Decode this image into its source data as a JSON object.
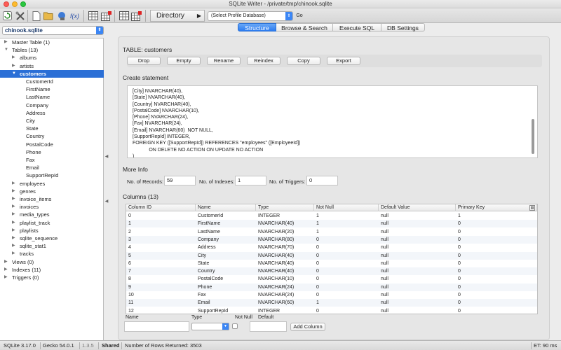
{
  "window": {
    "title": "SQLite Writer - /private/tmp/chinook.sqlite"
  },
  "toolbar": {
    "icons": [
      "refresh-icon",
      "tools-icon",
      "new-file-icon",
      "open-folder-icon",
      "save-icon",
      "function-icon",
      "table-icon",
      "table-delete-icon",
      "import-icon",
      "export-icon"
    ],
    "function_label": "f(x)",
    "directory_label": "Directory",
    "directory_arrow": "▶",
    "profile_select": "(Select Profile Database)",
    "go_label": "Go"
  },
  "sidebar": {
    "db_select": "chinook.sqlite",
    "tree": [
      {
        "label": "Master Table (1)",
        "indent": 0,
        "toggle": "▶",
        "selected": false
      },
      {
        "label": "Tables (13)",
        "indent": 0,
        "toggle": "▼",
        "selected": false
      },
      {
        "label": "albums",
        "indent": 1,
        "toggle": "▶",
        "selected": false
      },
      {
        "label": "artists",
        "indent": 1,
        "toggle": "▶",
        "selected": false
      },
      {
        "label": "customers",
        "indent": 1,
        "toggle": "▼",
        "selected": true
      },
      {
        "label": "CustomerId",
        "indent": 2,
        "toggle": "",
        "selected": false
      },
      {
        "label": "FirstName",
        "indent": 2,
        "toggle": "",
        "selected": false
      },
      {
        "label": "LastName",
        "indent": 2,
        "toggle": "",
        "selected": false
      },
      {
        "label": "Company",
        "indent": 2,
        "toggle": "",
        "selected": false
      },
      {
        "label": "Address",
        "indent": 2,
        "toggle": "",
        "selected": false
      },
      {
        "label": "City",
        "indent": 2,
        "toggle": "",
        "selected": false
      },
      {
        "label": "State",
        "indent": 2,
        "toggle": "",
        "selected": false
      },
      {
        "label": "Country",
        "indent": 2,
        "toggle": "",
        "selected": false
      },
      {
        "label": "PostalCode",
        "indent": 2,
        "toggle": "",
        "selected": false
      },
      {
        "label": "Phone",
        "indent": 2,
        "toggle": "",
        "selected": false
      },
      {
        "label": "Fax",
        "indent": 2,
        "toggle": "",
        "selected": false
      },
      {
        "label": "Email",
        "indent": 2,
        "toggle": "",
        "selected": false
      },
      {
        "label": "SupportRepId",
        "indent": 2,
        "toggle": "",
        "selected": false
      },
      {
        "label": "employees",
        "indent": 1,
        "toggle": "▶",
        "selected": false
      },
      {
        "label": "genres",
        "indent": 1,
        "toggle": "▶",
        "selected": false
      },
      {
        "label": "invoice_items",
        "indent": 1,
        "toggle": "▶",
        "selected": false
      },
      {
        "label": "invoices",
        "indent": 1,
        "toggle": "▶",
        "selected": false
      },
      {
        "label": "media_types",
        "indent": 1,
        "toggle": "▶",
        "selected": false
      },
      {
        "label": "playlist_track",
        "indent": 1,
        "toggle": "▶",
        "selected": false
      },
      {
        "label": "playlists",
        "indent": 1,
        "toggle": "▶",
        "selected": false
      },
      {
        "label": "sqlite_sequence",
        "indent": 1,
        "toggle": "▶",
        "selected": false
      },
      {
        "label": "sqlite_stat1",
        "indent": 1,
        "toggle": "▶",
        "selected": false
      },
      {
        "label": "tracks",
        "indent": 1,
        "toggle": "▶",
        "selected": false
      },
      {
        "label": "Views (0)",
        "indent": 0,
        "toggle": "▶",
        "selected": false
      },
      {
        "label": "Indexes (11)",
        "indent": 0,
        "toggle": "▶",
        "selected": false
      },
      {
        "label": "Triggers (0)",
        "indent": 0,
        "toggle": "▶",
        "selected": false
      }
    ]
  },
  "tabs": [
    {
      "label": "Structure",
      "active": true
    },
    {
      "label": "Browse & Search",
      "active": false
    },
    {
      "label": "Execute SQL",
      "active": false
    },
    {
      "label": "DB Settings",
      "active": false
    }
  ],
  "structure": {
    "table_title": "TABLE: customers",
    "buttons": [
      "Drop",
      "Empty",
      "Rename",
      "Reindex",
      "Copy",
      "Export"
    ],
    "create_title": "Create statement",
    "create_lines": [
      "[City] NVARCHAR(40),",
      "[State] NVARCHAR(40),",
      "[Country] NVARCHAR(40),",
      "[PostalCode] NVARCHAR(10),",
      "[Phone] NVARCHAR(24),",
      "[Fax] NVARCHAR(24),",
      "[Email] NVARCHAR(60)  NOT NULL,",
      "[SupportRepId] INTEGER,",
      "FOREIGN KEY ([SupportRepId]) REFERENCES \"employees\" ([EmployeeId])",
      "            ON DELETE NO ACTION ON UPDATE NO ACTION",
      ")"
    ],
    "more_info_title": "More Info",
    "records_label": "No. of Records:",
    "records_value": "59",
    "indexes_label": "No. of Indexes:",
    "indexes_value": "1",
    "triggers_label": "No. of Triggers:",
    "triggers_value": "0",
    "columns_title": "Columns (13)",
    "columns_headers": [
      "Column ID",
      "Name",
      "Type",
      "Not Null",
      "Default Value",
      "Primary Key"
    ],
    "columns_rows": [
      [
        "0",
        "CustomerId",
        "INTEGER",
        "1",
        "null",
        "1"
      ],
      [
        "1",
        "FirstName",
        "NVARCHAR(40)",
        "1",
        "null",
        "0"
      ],
      [
        "2",
        "LastName",
        "NVARCHAR(20)",
        "1",
        "null",
        "0"
      ],
      [
        "3",
        "Company",
        "NVARCHAR(80)",
        "0",
        "null",
        "0"
      ],
      [
        "4",
        "Address",
        "NVARCHAR(70)",
        "0",
        "null",
        "0"
      ],
      [
        "5",
        "City",
        "NVARCHAR(40)",
        "0",
        "null",
        "0"
      ],
      [
        "6",
        "State",
        "NVARCHAR(40)",
        "0",
        "null",
        "0"
      ],
      [
        "7",
        "Country",
        "NVARCHAR(40)",
        "0",
        "null",
        "0"
      ],
      [
        "8",
        "PostalCode",
        "NVARCHAR(10)",
        "0",
        "null",
        "0"
      ],
      [
        "9",
        "Phone",
        "NVARCHAR(24)",
        "0",
        "null",
        "0"
      ],
      [
        "10",
        "Fax",
        "NVARCHAR(24)",
        "0",
        "null",
        "0"
      ],
      [
        "11",
        "Email",
        "NVARCHAR(60)",
        "1",
        "null",
        "0"
      ],
      [
        "12",
        "SupportRepId",
        "INTEGER",
        "0",
        "null",
        "0"
      ]
    ],
    "add_column": {
      "name_label": "Name",
      "type_label": "Type",
      "notnull_label": "Not Null",
      "default_label": "Default",
      "button": "Add Column"
    }
  },
  "statusbar": {
    "sqlite_version": "SQLite 3.17.0",
    "gecko_version": "Gecko 54.0.1",
    "app_version": "1.3.5",
    "mode": "Shared",
    "rows_returned": "Number of Rows Returned: 3503",
    "elapsed": "ET: 90 ms"
  },
  "colors": {
    "accent": "#2c7cf0",
    "selection": "#2b6fd6"
  }
}
